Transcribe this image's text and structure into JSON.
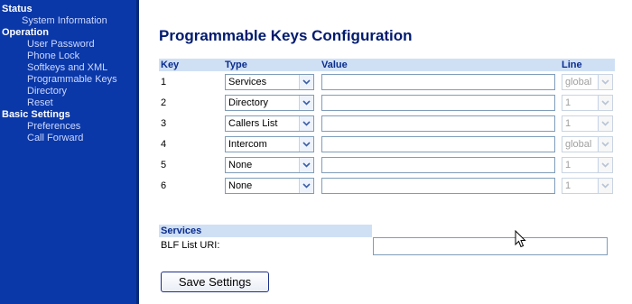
{
  "sidebar": {
    "sections": [
      {
        "title": "Status",
        "items": [
          {
            "label": "System Information"
          }
        ]
      },
      {
        "title": "Operation",
        "items": [
          {
            "label": "User Password"
          },
          {
            "label": "Phone Lock"
          },
          {
            "label": "Softkeys and XML"
          },
          {
            "label": "Programmable Keys"
          },
          {
            "label": "Directory"
          },
          {
            "label": "Reset"
          }
        ]
      },
      {
        "title": "Basic Settings",
        "items": [
          {
            "label": "Preferences"
          },
          {
            "label": "Call Forward"
          }
        ]
      }
    ]
  },
  "page": {
    "title": "Programmable Keys Configuration"
  },
  "table": {
    "headers": {
      "key": "Key",
      "type": "Type",
      "value": "Value",
      "line": "Line"
    },
    "rows": [
      {
        "key": "1",
        "type": "Services",
        "value": "",
        "line": "global"
      },
      {
        "key": "2",
        "type": "Directory",
        "value": "",
        "line": "1"
      },
      {
        "key": "3",
        "type": "Callers List",
        "value": "",
        "line": "1"
      },
      {
        "key": "4",
        "type": "Intercom",
        "value": "",
        "line": "global"
      },
      {
        "key": "5",
        "type": "None",
        "value": "",
        "line": "1"
      },
      {
        "key": "6",
        "type": "None",
        "value": "",
        "line": "1"
      }
    ]
  },
  "services": {
    "header": "Services",
    "blf_label": "BLF List URI:",
    "blf_value": ""
  },
  "save_button": "Save Settings",
  "colors": {
    "sidebar_bg": "#0a38a8",
    "header_bg": "#cfe0f5",
    "title": "#001a6e"
  },
  "icons": {
    "dropdown": "chevron-down-icon",
    "cursor": "mouse-pointer-icon"
  }
}
